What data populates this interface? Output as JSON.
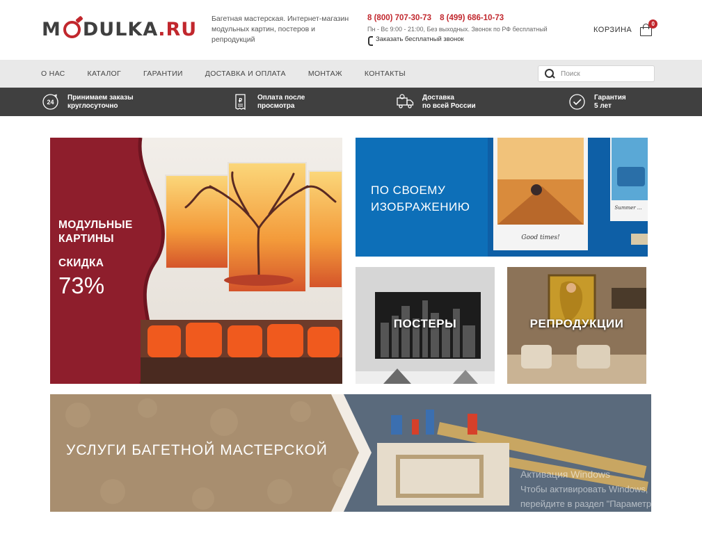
{
  "header": {
    "logo": {
      "part1": "M",
      "part2": "DULKA",
      "dot": ".",
      "ru": "RU"
    },
    "tagline": "Багетная мастерская. Интернет-магазин модульных картин, постеров и репродукций",
    "phones": [
      "8 (800) 707-30-73",
      "8 (499) 686-10-73"
    ],
    "hours": "Пн - Вс 9:00 - 21:00, Без выходных. Звонок по РФ бесплатный",
    "callback": "Заказать бесплатный звонок",
    "cart": {
      "label": "КОРЗИНА",
      "count": "0"
    }
  },
  "nav": {
    "items": [
      "О НАС",
      "КАТАЛОГ",
      "ГАРАНТИИ",
      "ДОСТАВКА И ОПЛАТА",
      "МОНТАЖ",
      "КОНТАКТЫ"
    ],
    "search_placeholder": "Поиск"
  },
  "features": [
    {
      "icon": "24h-clock-icon",
      "line1": "Принимаем заказы",
      "line2": "круглосуточно",
      "badge": "24"
    },
    {
      "icon": "receipt-icon",
      "line1": "Оплата после",
      "line2": "просмотра"
    },
    {
      "icon": "delivery-truck-icon",
      "line1": "Доставка",
      "line2": "по всей России"
    },
    {
      "icon": "checkmark-icon",
      "line1": "Гарантия",
      "line2": "5 лет"
    }
  ],
  "banners": {
    "modular": {
      "title": "МОДУЛЬНЫЕ КАРТИНЫ",
      "discount_label": "СКИДКА",
      "discount_value": "73%"
    },
    "custom": {
      "title": "ПО СВОЕМУ ИЗОБРАЖЕНИЮ",
      "photo_caption_1": "Good times!",
      "photo_caption_2": "Summer ..."
    },
    "posters": {
      "title": "ПОСТЕРЫ"
    },
    "reproductions": {
      "title": "РЕПРОДУКЦИИ"
    },
    "services": {
      "title": "УСЛУГИ БАГЕТНОЙ МАСТЕРСКОЙ"
    }
  },
  "watermark": {
    "line1": "Активация Windows",
    "line2": "Чтобы активировать Windows,",
    "line3": "перейдите в раздел \"Параметры\"."
  },
  "colors": {
    "brand_red": "#c1272d",
    "nav_bg": "#e9e9e9",
    "features_bg": "#404040",
    "custom_blue": "#0d6fb8"
  }
}
